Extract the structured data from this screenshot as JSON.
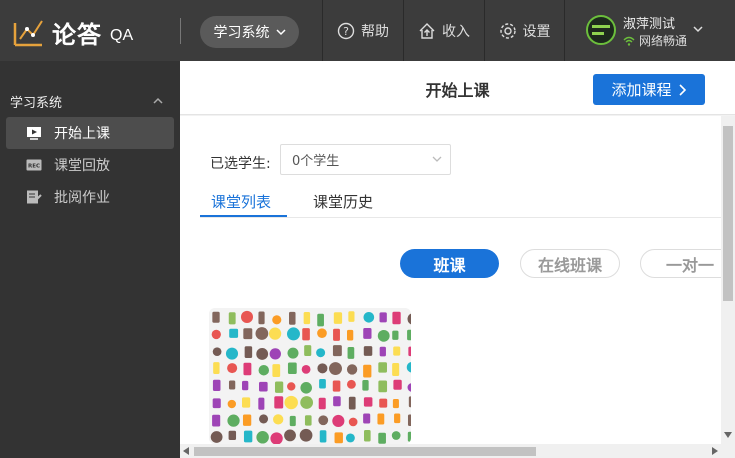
{
  "app": {
    "logo_cn": "论答",
    "logo_qa": "QA"
  },
  "topbar": {
    "system_button": "学习系统",
    "help": "帮助",
    "income": "收入",
    "settings": "设置"
  },
  "user": {
    "name": "淑萍测试",
    "status": "网络畅通"
  },
  "sidebar": {
    "section": "学习系统",
    "items": [
      {
        "label": "开始上课",
        "icon": "play-screen-icon",
        "active": true
      },
      {
        "label": "课堂回放",
        "icon": "rec-icon",
        "active": false
      },
      {
        "label": "批阅作业",
        "icon": "edit-doc-icon",
        "active": false
      }
    ]
  },
  "header": {
    "title": "开始上课",
    "add_button": "添加课程"
  },
  "filter": {
    "label": "已选学生:",
    "value": "0个学生"
  },
  "tabs": [
    {
      "label": "课堂列表",
      "active": true
    },
    {
      "label": "课堂历史",
      "active": false
    }
  ],
  "class_types": [
    {
      "label": "班课",
      "active": true
    },
    {
      "label": "在线班课",
      "active": false
    },
    {
      "label": "一对一",
      "active": false
    }
  ],
  "colors": {
    "accent": "#1a73d9",
    "topbar": "#3c3c3c",
    "sidebar": "#333333",
    "online": "#6cbf3c"
  }
}
